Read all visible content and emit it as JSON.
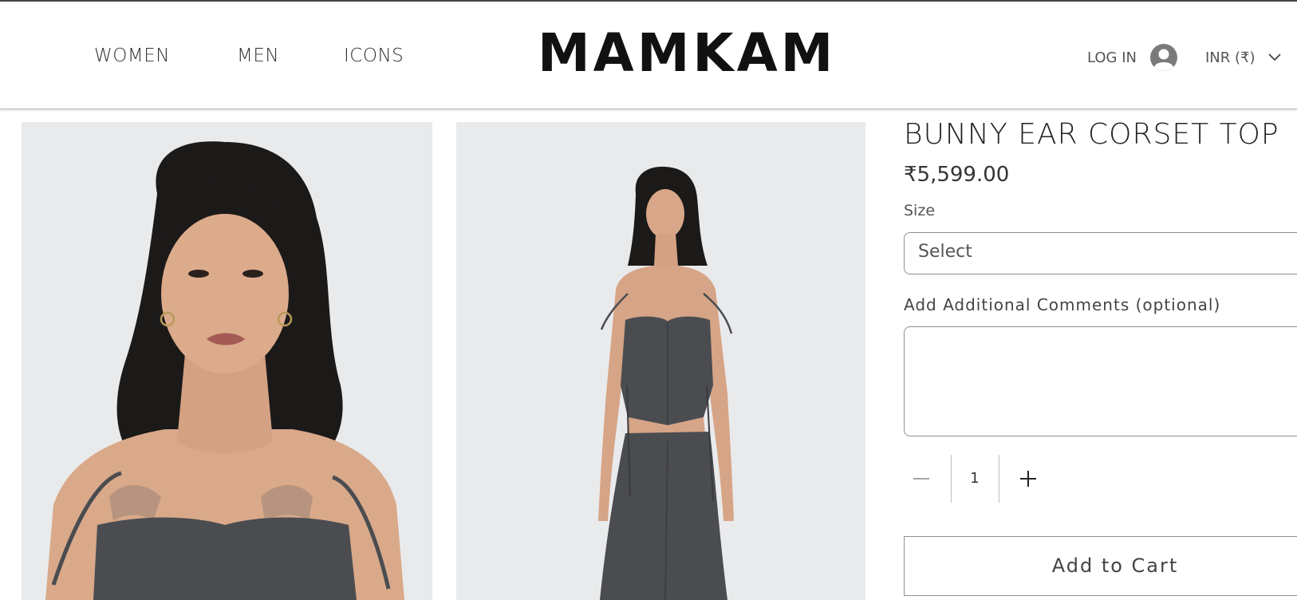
{
  "header": {
    "nav": [
      "WOMEN",
      "MEN",
      "ICONS"
    ],
    "logo": "MAMKAM",
    "login_label": "LOG IN",
    "currency": "INR (₹)"
  },
  "product": {
    "title": "BUNNY EAR CORSET TOP",
    "price": "₹5,599.00",
    "size_label": "Size",
    "size_value": "Select",
    "comments_label": "Add Additional Comments (optional)",
    "quantity": "1",
    "add_to_cart_label": "Add to Cart"
  },
  "icons": {
    "account": "user-avatar-icon",
    "currency_dropdown": "chevron-down-icon",
    "decrease": "minus-icon",
    "increase": "plus-icon"
  },
  "colors": {
    "text": "#222222",
    "border": "#8f8f8f",
    "garment": "#4a4c50",
    "photo_background": "#ececec"
  }
}
